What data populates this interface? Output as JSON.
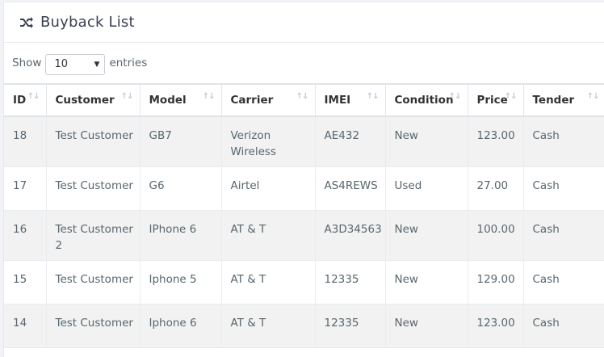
{
  "header": {
    "title": "Buyback List",
    "icon": "shuffle-icon"
  },
  "length": {
    "show_label": "Show",
    "selected": "10",
    "entries_label": "entries"
  },
  "table": {
    "columns": [
      "ID",
      "Customer",
      "Model",
      "Carrier",
      "IMEI",
      "Condition",
      "Price",
      "Tender"
    ],
    "rows": [
      [
        "18",
        "Test Customer",
        "GB7",
        "Verizon Wireless",
        "AE432",
        "New",
        "123.00",
        "Cash"
      ],
      [
        "17",
        "Test Customer",
        "G6",
        "Airtel",
        "AS4REWS",
        "Used",
        "27.00",
        "Cash"
      ],
      [
        "16",
        "Test Customer 2",
        "IPhone 6",
        "AT & T",
        "A3D34563",
        "New",
        "100.00",
        "Cash"
      ],
      [
        "15",
        "Test Customer",
        "Iphone 5",
        "AT & T",
        "12335",
        "New",
        "129.00",
        "Cash"
      ],
      [
        "14",
        "Test Customer",
        "Iphone 6",
        "AT & T",
        "12335",
        "New",
        "123.00",
        "Cash"
      ]
    ]
  }
}
